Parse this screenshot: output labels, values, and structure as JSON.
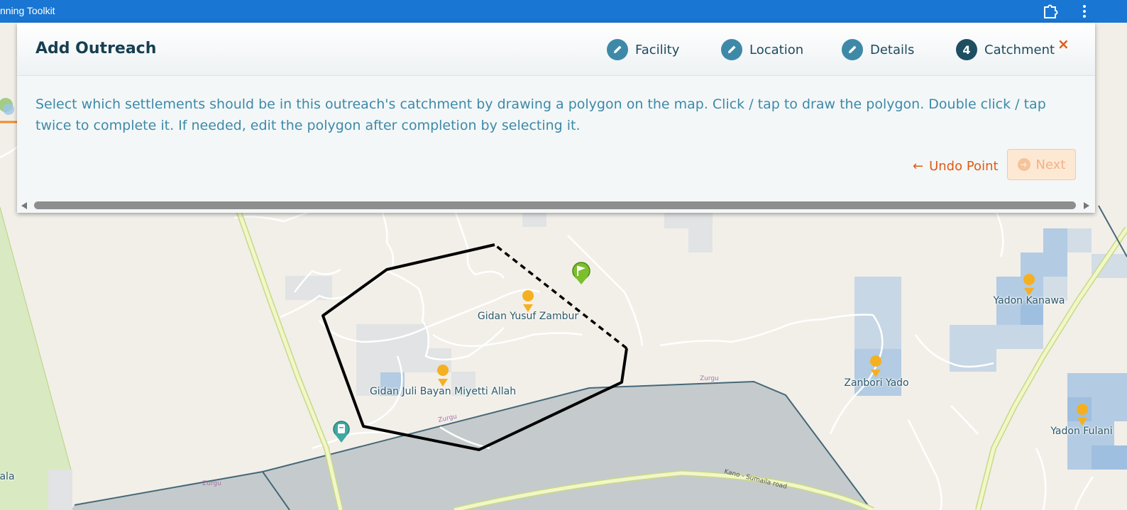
{
  "app": {
    "title": "nning Toolkit"
  },
  "dialog": {
    "title": "Add Outreach",
    "steps": [
      {
        "label": "Facility",
        "state": "done",
        "icon": "pencil-icon"
      },
      {
        "label": "Location",
        "state": "done",
        "icon": "pencil-icon"
      },
      {
        "label": "Details",
        "state": "done",
        "icon": "pencil-icon"
      },
      {
        "label": "Catchment",
        "state": "current",
        "number": "4"
      }
    ],
    "close_label": "×",
    "instructions": "Select which settlements should be in this outreach's catchment by drawing a polygon on the map. Click / tap to draw the polygon. Double click / tap twice to complete it. If needed, edit the polygon after completion by selecting it.",
    "undo_label": "Undo Point",
    "next_label": "Next"
  },
  "map": {
    "settlements": [
      "Gidan Yusuf Zambur",
      "Gidan Juli Bayan Miyetti Allah",
      "Yadon Kanawa",
      "Zanbori Yado",
      "Yadon Fulani",
      "ala"
    ],
    "road_labels": [
      "Zurgu",
      "Zurgu",
      "Kano - Sumaila road"
    ],
    "colors": {
      "polygon": "#000000",
      "settlement_marker": "#f5b021",
      "area_fill": "#aab5b8",
      "area_border": "#466878"
    }
  }
}
